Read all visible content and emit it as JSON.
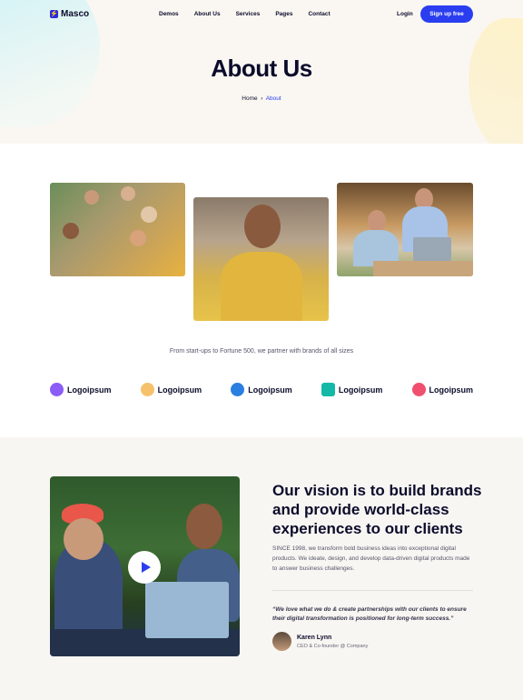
{
  "brand": {
    "name": "Masco",
    "logo_icon": "bolt-icon",
    "accent": "#2a3ef0"
  },
  "nav": {
    "items": [
      {
        "label": "Demos"
      },
      {
        "label": "About Us"
      },
      {
        "label": "Services"
      },
      {
        "label": "Pages"
      },
      {
        "label": "Contact"
      }
    ],
    "login_label": "Login",
    "signup_label": "Sign up free"
  },
  "hero": {
    "title": "About Us",
    "breadcrumb": {
      "home": "Home",
      "separator": "›",
      "current": "About"
    }
  },
  "partners": {
    "tagline": "From start-ups to Fortune 500, we partner with brands of all sizes",
    "logos": [
      {
        "label": "Logoipsum",
        "color": "#8b5cf6"
      },
      {
        "label": "Logoipsum",
        "color": "#f5c26b"
      },
      {
        "label": "Logoipsum",
        "color": "#2a7fe0"
      },
      {
        "label": "Logoipsum",
        "color": "#14b8a6"
      },
      {
        "label": "Logoipsum",
        "color": "#f0506e"
      }
    ]
  },
  "vision": {
    "title": "Our vision is to build brands and provide world-class experiences to our clients",
    "body": "SINCE 1998, we transform bold business ideas into exceptional digital products. We ideate, design, and develop data-driven digital products made to answer business challenges.",
    "quote": "“We love what we do & create partnerships with our clients to ensure their digital transformation is positioned for long-term success.”",
    "author_name": "Karen Lynn",
    "author_role": "CEO & Co-founder @ Company"
  }
}
